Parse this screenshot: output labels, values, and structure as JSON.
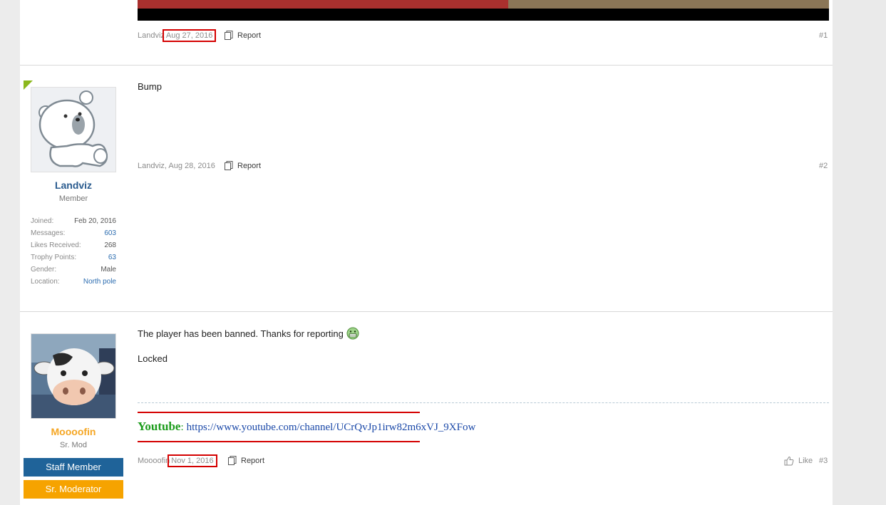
{
  "post1": {
    "author": "Landviz",
    "date": "Aug 27, 2016",
    "report_label": "Report",
    "number": "#1"
  },
  "post2": {
    "author_name": "Landviz",
    "user_title": "Member",
    "stats": [
      {
        "label": "Joined:",
        "value": "Feb 20, 2016"
      },
      {
        "label": "Messages:",
        "value": "603"
      },
      {
        "label": "Likes Received:",
        "value": "268"
      },
      {
        "label": "Trophy Points:",
        "value": "63"
      },
      {
        "label": "Gender:",
        "value": "Male"
      },
      {
        "label": "Location:",
        "value": "North pole"
      }
    ],
    "message": "Bump",
    "meta": "Landviz, Aug 28, 2016",
    "report_label": "Report",
    "number": "#2"
  },
  "post3": {
    "author_name": "Moooofin",
    "user_title": "Sr. Mod",
    "banners": [
      "Staff Member",
      "Sr. Moderator"
    ],
    "message_line1": "The player has been banned. Thanks for reporting",
    "message_line2": "Locked",
    "signature": {
      "label": "Youtube",
      "colon": ":",
      "link": "https://www.youtube.com/channel/UCrQvJp1irw82m6xVJ_9XFow"
    },
    "author": "Moooofin",
    "date": "Nov 1, 2016",
    "report_label": "Report",
    "like_label": "Like",
    "number": "#3"
  },
  "colors": {
    "accent_green": "#8cb81d",
    "staff_banner": "#1f6399",
    "moderator_banner": "#f6a300",
    "highlight_box": "#d40000",
    "username_member": "#2b5c8f",
    "username_mod": "#f5a623"
  }
}
